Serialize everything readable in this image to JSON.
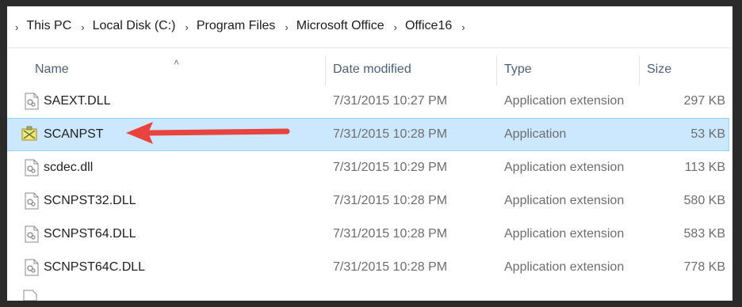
{
  "breadcrumb": {
    "items": [
      "This PC",
      "Local Disk (C:)",
      "Program Files",
      "Microsoft Office",
      "Office16"
    ]
  },
  "columns": {
    "name": "Name",
    "date": "Date modified",
    "type": "Type",
    "size": "Size"
  },
  "files": [
    {
      "name": "SAEXT.DLL",
      "date": "7/31/2015 10:27 PM",
      "type": "Application extension",
      "size": "297 KB",
      "icon": "dll-file-icon"
    },
    {
      "name": "SCANPST",
      "date": "7/31/2015 10:28 PM",
      "type": "Application",
      "size": "53 KB",
      "icon": "scanpst-app-icon",
      "selected": true
    },
    {
      "name": "scdec.dll",
      "date": "7/31/2015 10:29 PM",
      "type": "Application extension",
      "size": "113 KB",
      "icon": "dll-file-icon"
    },
    {
      "name": "SCNPST32.DLL",
      "date": "7/31/2015 10:28 PM",
      "type": "Application extension",
      "size": "580 KB",
      "icon": "dll-file-icon"
    },
    {
      "name": "SCNPST64.DLL",
      "date": "7/31/2015 10:28 PM",
      "type": "Application extension",
      "size": "583 KB",
      "icon": "dll-file-icon"
    },
    {
      "name": "SCNPST64C.DLL",
      "date": "7/31/2015 10:28 PM",
      "type": "Application extension",
      "size": "778 KB",
      "icon": "dll-file-icon"
    }
  ],
  "colors": {
    "selection_bg": "#cce8ff",
    "selection_border": "#99d1ff",
    "annotation_arrow": "#e8433e",
    "header_text": "#4c607a"
  }
}
